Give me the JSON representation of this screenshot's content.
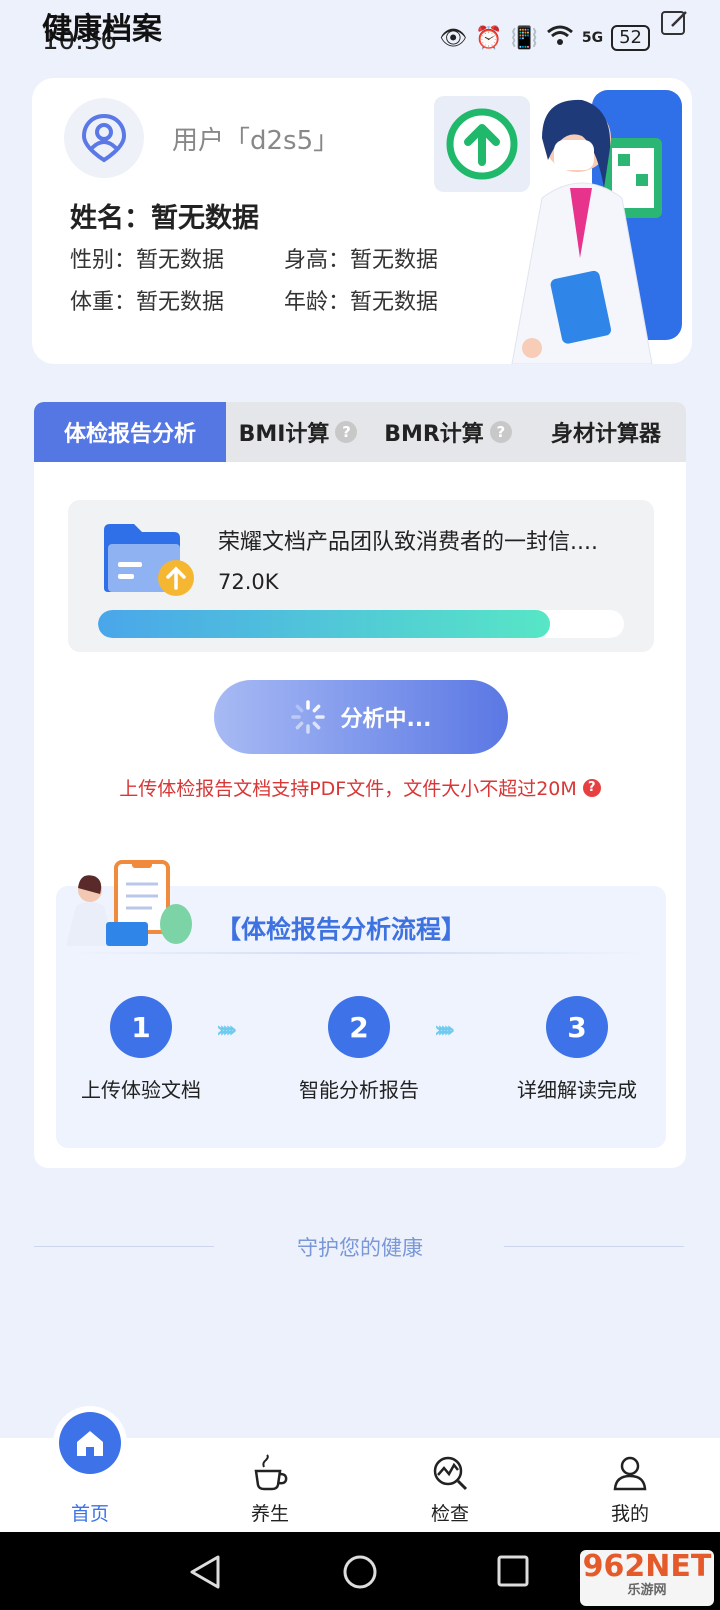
{
  "status_bar": {
    "time": "10:36",
    "app_title": "健康档案",
    "battery": "52",
    "network": "5G"
  },
  "profile": {
    "user_name": "用户「d2s5」",
    "name_label": "姓名：暂无数据",
    "gender": "性别：暂无数据",
    "height": "身高：暂无数据",
    "weight": "体重：暂无数据",
    "age": "年龄：暂无数据"
  },
  "tabs": [
    {
      "label": "体检报告分析"
    },
    {
      "label": "BMI计算"
    },
    {
      "label": "BMR计算"
    },
    {
      "label": "身材计算器"
    }
  ],
  "upload": {
    "file_name": "荣耀文档产品团队致消费者的一封信....",
    "file_size": "72.0K",
    "progress": 0.86,
    "button_label": "分析中...",
    "hint": "上传体检报告文档支持PDF文件，文件大小不超过20M"
  },
  "process": {
    "title": "【体检报告分析流程】",
    "steps": [
      {
        "num": "1",
        "label": "上传体验文档"
      },
      {
        "num": "2",
        "label": "智能分析报告"
      },
      {
        "num": "3",
        "label": "详细解读完成"
      }
    ]
  },
  "footer": {
    "slogan": "守护您的健康"
  },
  "bottom_nav": [
    {
      "label": "首页",
      "icon": "home-icon"
    },
    {
      "label": "养生",
      "icon": "tea-cup-icon"
    },
    {
      "label": "检查",
      "icon": "chart-search-icon"
    },
    {
      "label": "我的",
      "icon": "person-icon"
    }
  ],
  "colors": {
    "accent": "#3d72e8",
    "tab_active": "#5577e4",
    "hint_red": "#d93636"
  },
  "watermark": {
    "main": "962NET",
    "sub": "乐游网"
  }
}
